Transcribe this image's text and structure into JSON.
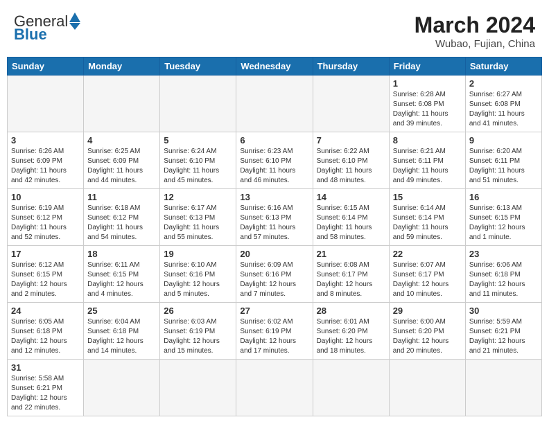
{
  "header": {
    "logo_general": "General",
    "logo_blue": "Blue",
    "month_year": "March 2024",
    "location": "Wubao, Fujian, China"
  },
  "weekdays": [
    "Sunday",
    "Monday",
    "Tuesday",
    "Wednesday",
    "Thursday",
    "Friday",
    "Saturday"
  ],
  "weeks": [
    [
      {
        "day": "",
        "info": ""
      },
      {
        "day": "",
        "info": ""
      },
      {
        "day": "",
        "info": ""
      },
      {
        "day": "",
        "info": ""
      },
      {
        "day": "",
        "info": ""
      },
      {
        "day": "1",
        "info": "Sunrise: 6:28 AM\nSunset: 6:08 PM\nDaylight: 11 hours and 39 minutes."
      },
      {
        "day": "2",
        "info": "Sunrise: 6:27 AM\nSunset: 6:08 PM\nDaylight: 11 hours and 41 minutes."
      }
    ],
    [
      {
        "day": "3",
        "info": "Sunrise: 6:26 AM\nSunset: 6:09 PM\nDaylight: 11 hours and 42 minutes."
      },
      {
        "day": "4",
        "info": "Sunrise: 6:25 AM\nSunset: 6:09 PM\nDaylight: 11 hours and 44 minutes."
      },
      {
        "day": "5",
        "info": "Sunrise: 6:24 AM\nSunset: 6:10 PM\nDaylight: 11 hours and 45 minutes."
      },
      {
        "day": "6",
        "info": "Sunrise: 6:23 AM\nSunset: 6:10 PM\nDaylight: 11 hours and 46 minutes."
      },
      {
        "day": "7",
        "info": "Sunrise: 6:22 AM\nSunset: 6:10 PM\nDaylight: 11 hours and 48 minutes."
      },
      {
        "day": "8",
        "info": "Sunrise: 6:21 AM\nSunset: 6:11 PM\nDaylight: 11 hours and 49 minutes."
      },
      {
        "day": "9",
        "info": "Sunrise: 6:20 AM\nSunset: 6:11 PM\nDaylight: 11 hours and 51 minutes."
      }
    ],
    [
      {
        "day": "10",
        "info": "Sunrise: 6:19 AM\nSunset: 6:12 PM\nDaylight: 11 hours and 52 minutes."
      },
      {
        "day": "11",
        "info": "Sunrise: 6:18 AM\nSunset: 6:12 PM\nDaylight: 11 hours and 54 minutes."
      },
      {
        "day": "12",
        "info": "Sunrise: 6:17 AM\nSunset: 6:13 PM\nDaylight: 11 hours and 55 minutes."
      },
      {
        "day": "13",
        "info": "Sunrise: 6:16 AM\nSunset: 6:13 PM\nDaylight: 11 hours and 57 minutes."
      },
      {
        "day": "14",
        "info": "Sunrise: 6:15 AM\nSunset: 6:14 PM\nDaylight: 11 hours and 58 minutes."
      },
      {
        "day": "15",
        "info": "Sunrise: 6:14 AM\nSunset: 6:14 PM\nDaylight: 11 hours and 59 minutes."
      },
      {
        "day": "16",
        "info": "Sunrise: 6:13 AM\nSunset: 6:15 PM\nDaylight: 12 hours and 1 minute."
      }
    ],
    [
      {
        "day": "17",
        "info": "Sunrise: 6:12 AM\nSunset: 6:15 PM\nDaylight: 12 hours and 2 minutes."
      },
      {
        "day": "18",
        "info": "Sunrise: 6:11 AM\nSunset: 6:15 PM\nDaylight: 12 hours and 4 minutes."
      },
      {
        "day": "19",
        "info": "Sunrise: 6:10 AM\nSunset: 6:16 PM\nDaylight: 12 hours and 5 minutes."
      },
      {
        "day": "20",
        "info": "Sunrise: 6:09 AM\nSunset: 6:16 PM\nDaylight: 12 hours and 7 minutes."
      },
      {
        "day": "21",
        "info": "Sunrise: 6:08 AM\nSunset: 6:17 PM\nDaylight: 12 hours and 8 minutes."
      },
      {
        "day": "22",
        "info": "Sunrise: 6:07 AM\nSunset: 6:17 PM\nDaylight: 12 hours and 10 minutes."
      },
      {
        "day": "23",
        "info": "Sunrise: 6:06 AM\nSunset: 6:18 PM\nDaylight: 12 hours and 11 minutes."
      }
    ],
    [
      {
        "day": "24",
        "info": "Sunrise: 6:05 AM\nSunset: 6:18 PM\nDaylight: 12 hours and 12 minutes."
      },
      {
        "day": "25",
        "info": "Sunrise: 6:04 AM\nSunset: 6:18 PM\nDaylight: 12 hours and 14 minutes."
      },
      {
        "day": "26",
        "info": "Sunrise: 6:03 AM\nSunset: 6:19 PM\nDaylight: 12 hours and 15 minutes."
      },
      {
        "day": "27",
        "info": "Sunrise: 6:02 AM\nSunset: 6:19 PM\nDaylight: 12 hours and 17 minutes."
      },
      {
        "day": "28",
        "info": "Sunrise: 6:01 AM\nSunset: 6:20 PM\nDaylight: 12 hours and 18 minutes."
      },
      {
        "day": "29",
        "info": "Sunrise: 6:00 AM\nSunset: 6:20 PM\nDaylight: 12 hours and 20 minutes."
      },
      {
        "day": "30",
        "info": "Sunrise: 5:59 AM\nSunset: 6:21 PM\nDaylight: 12 hours and 21 minutes."
      }
    ],
    [
      {
        "day": "31",
        "info": "Sunrise: 5:58 AM\nSunset: 6:21 PM\nDaylight: 12 hours and 22 minutes."
      },
      {
        "day": "",
        "info": ""
      },
      {
        "day": "",
        "info": ""
      },
      {
        "day": "",
        "info": ""
      },
      {
        "day": "",
        "info": ""
      },
      {
        "day": "",
        "info": ""
      },
      {
        "day": "",
        "info": ""
      }
    ]
  ]
}
